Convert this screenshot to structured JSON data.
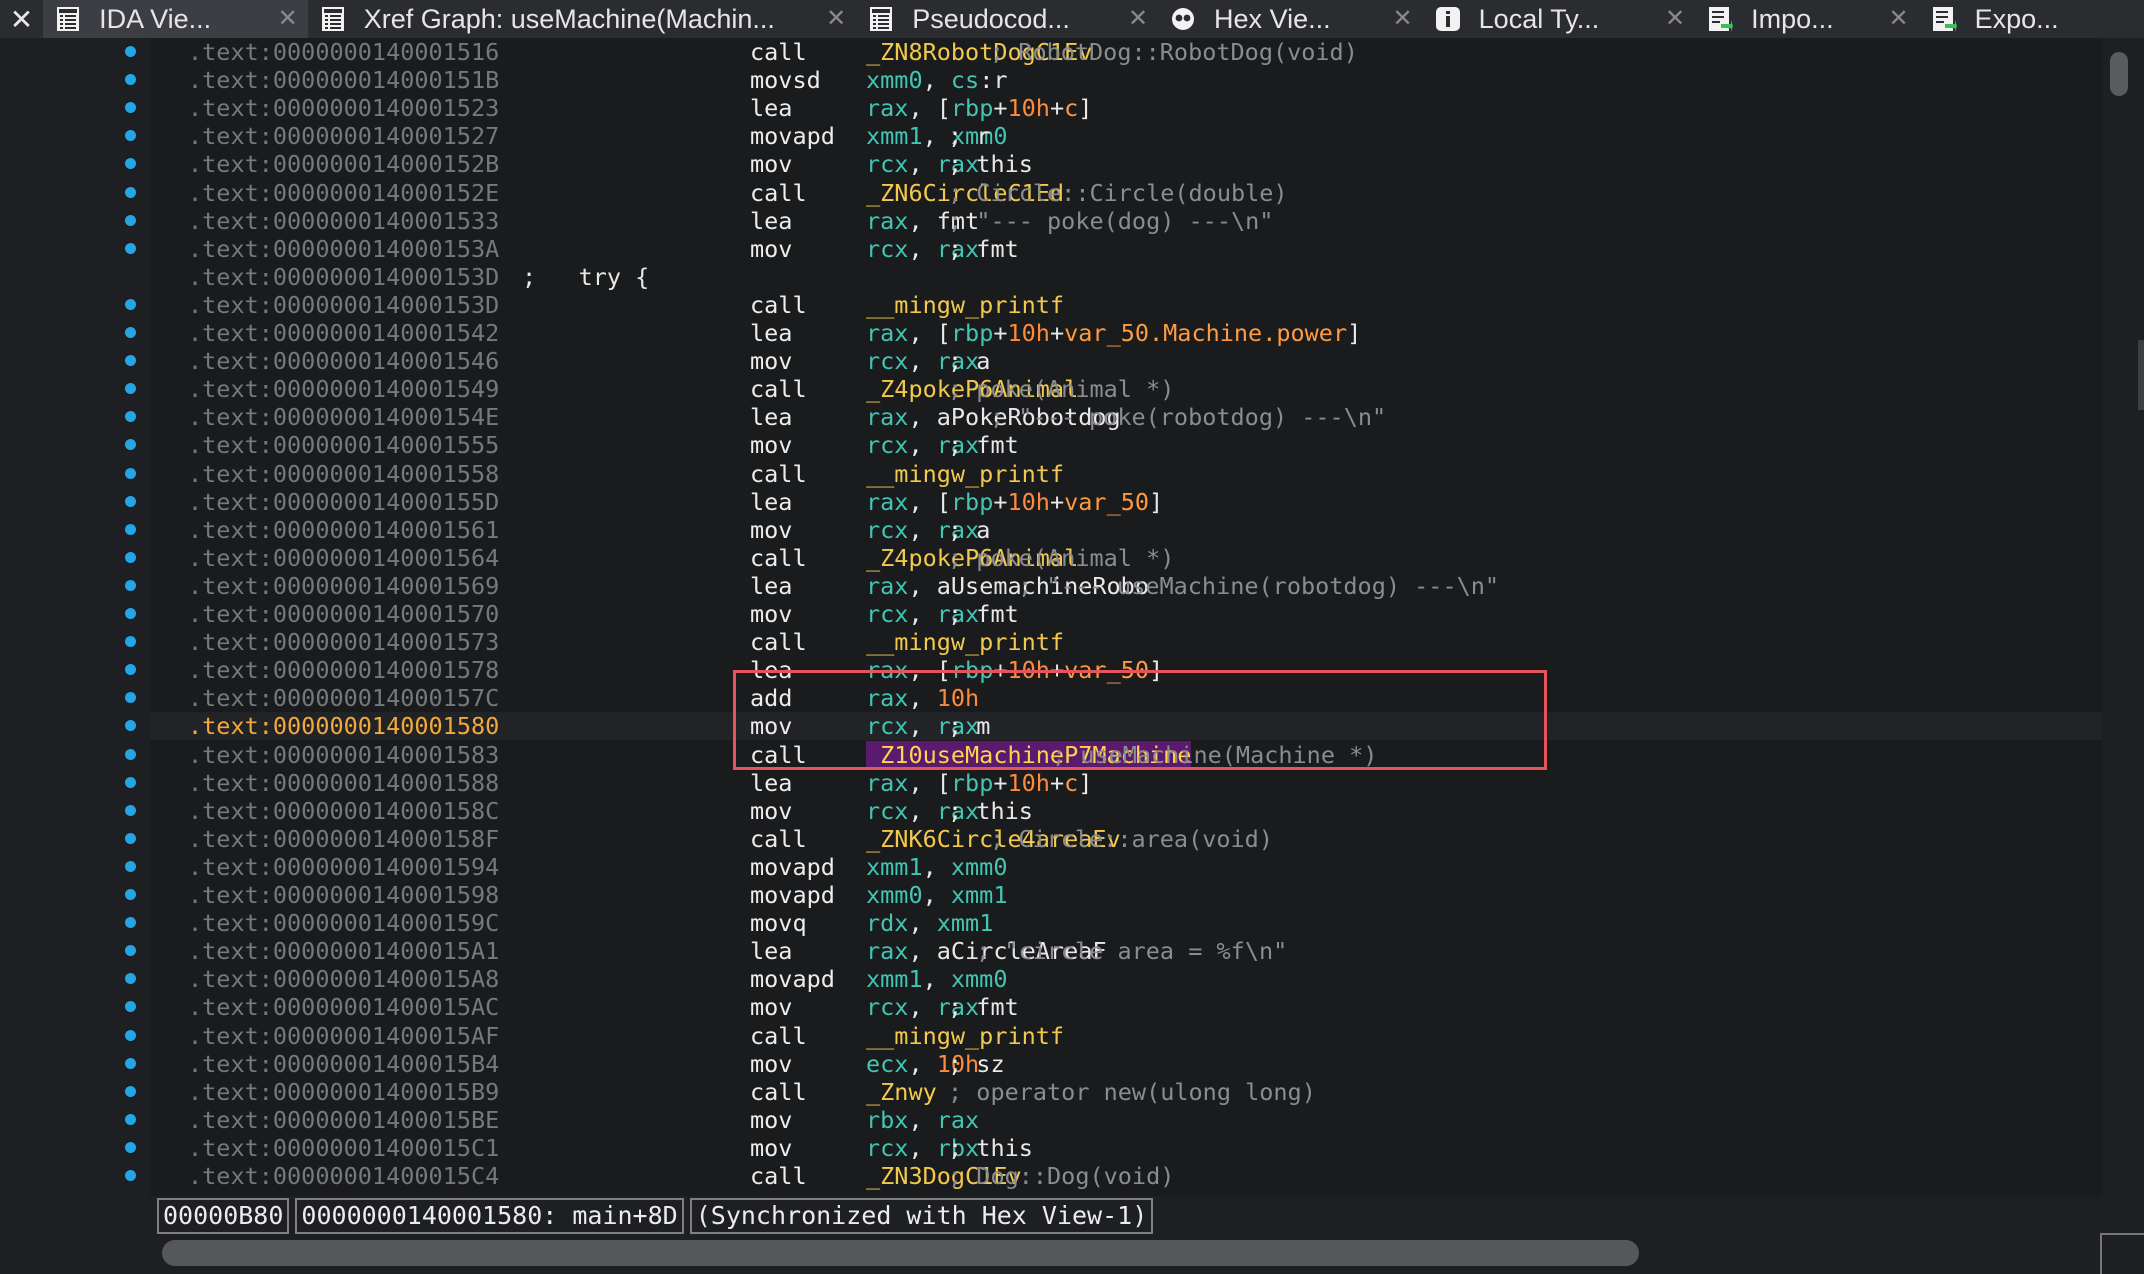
{
  "tabs": [
    {
      "label": "IDA Vie...",
      "icon": "ida-view-icon",
      "active": true,
      "width": 270
    },
    {
      "label": "Xref Graph: useMachine(Machin...",
      "icon": "xref-graph-icon",
      "active": false,
      "width": 560
    },
    {
      "label": "Pseudocod...",
      "icon": "pseudocode-icon",
      "active": false,
      "width": 308
    },
    {
      "label": "Hex Vie...",
      "icon": "hex-view-icon",
      "active": false,
      "width": 270
    },
    {
      "label": "Local Ty...",
      "icon": "local-types-icon",
      "active": false,
      "width": 278
    },
    {
      "label": "Impo...",
      "icon": "imports-icon",
      "active": false,
      "width": 228
    },
    {
      "label": "Expo...",
      "icon": "exports-icon",
      "active": false,
      "width": 230
    }
  ],
  "listing": [
    {
      "addr": ".text:0000000140001516",
      "mn": "call",
      "ops": [
        [
          "s",
          "_ZN8RobotDogC1Ev"
        ]
      ],
      "cmt": "; RobotDog::RobotDog(void)",
      "cmtx": 990
    },
    {
      "addr": ".text:000000014000151B",
      "mn": "movsd",
      "ops": [
        [
          "r",
          "xmm0"
        ],
        [
          "o",
          ", "
        ],
        [
          "r",
          "cs"
        ],
        [
          "o",
          ":r"
        ]
      ]
    },
    {
      "addr": ".text:0000000140001523",
      "mn": "lea",
      "ops": [
        [
          "r",
          "rax"
        ],
        [
          "o",
          ", ["
        ],
        [
          "r",
          "rbp"
        ],
        [
          "o",
          "+"
        ],
        [
          "n",
          "10h"
        ],
        [
          "o",
          "+"
        ],
        [
          "v",
          "c"
        ],
        [
          "o",
          "]"
        ]
      ]
    },
    {
      "addr": ".text:0000000140001527",
      "mn": "movapd",
      "ops": [
        [
          "r",
          "xmm1"
        ],
        [
          "o",
          ", "
        ],
        [
          "r",
          "xmm0"
        ]
      ],
      "cmt": "; r",
      "cmtx": 948,
      "cmtcls": "o"
    },
    {
      "addr": ".text:000000014000152B",
      "mn": "mov",
      "ops": [
        [
          "r",
          "rcx"
        ],
        [
          "o",
          ", "
        ],
        [
          "r",
          "rax"
        ]
      ],
      "cmt": "; this",
      "cmtx": 948,
      "cmtcls": "o"
    },
    {
      "addr": ".text:000000014000152E",
      "mn": "call",
      "ops": [
        [
          "s",
          "_ZN6CircleC1Ed"
        ]
      ],
      "cmt": "; Circle::Circle(double)",
      "cmtx": 948
    },
    {
      "addr": ".text:0000000140001533",
      "mn": "lea",
      "ops": [
        [
          "r",
          "rax"
        ],
        [
          "o",
          ", fmt"
        ]
      ],
      "cmt": "; \"--- poke(dog) ---\\n\"",
      "cmtx": 948
    },
    {
      "addr": ".text:000000014000153A",
      "mn": "mov",
      "ops": [
        [
          "r",
          "rcx"
        ],
        [
          "o",
          ", "
        ],
        [
          "r",
          "rax"
        ]
      ],
      "cmt": "; fmt",
      "cmtx": 948,
      "cmtcls": "o"
    },
    {
      "addr": ".text:000000014000153D",
      "try": ";   try {"
    },
    {
      "addr": ".text:000000014000153D",
      "mn": "call",
      "ops": [
        [
          "s",
          "__mingw_printf"
        ]
      ]
    },
    {
      "addr": ".text:0000000140001542",
      "mn": "lea",
      "ops": [
        [
          "r",
          "rax"
        ],
        [
          "o",
          ", ["
        ],
        [
          "r",
          "rbp"
        ],
        [
          "o",
          "+"
        ],
        [
          "n",
          "10h"
        ],
        [
          "o",
          "+"
        ],
        [
          "v",
          "var_50.Machine.power"
        ],
        [
          "o",
          "]"
        ]
      ]
    },
    {
      "addr": ".text:0000000140001546",
      "mn": "mov",
      "ops": [
        [
          "r",
          "rcx"
        ],
        [
          "o",
          ", "
        ],
        [
          "r",
          "rax"
        ]
      ],
      "cmt": "; a",
      "cmtx": 948,
      "cmtcls": "o"
    },
    {
      "addr": ".text:0000000140001549",
      "mn": "call",
      "ops": [
        [
          "s",
          "_Z4pokeP6Animal"
        ]
      ],
      "cmt": "; poke(Animal *)",
      "cmtx": 948
    },
    {
      "addr": ".text:000000014000154E",
      "mn": "lea",
      "ops": [
        [
          "r",
          "rax"
        ],
        [
          "o",
          ", aPokeRobotdog"
        ]
      ],
      "cmt": "; \"--- poke(robotdog) ---\\n\"",
      "cmtx": 990
    },
    {
      "addr": ".text:0000000140001555",
      "mn": "mov",
      "ops": [
        [
          "r",
          "rcx"
        ],
        [
          "o",
          ", "
        ],
        [
          "r",
          "rax"
        ]
      ],
      "cmt": "; fmt",
      "cmtx": 948,
      "cmtcls": "o"
    },
    {
      "addr": ".text:0000000140001558",
      "mn": "call",
      "ops": [
        [
          "s",
          "__mingw_printf"
        ]
      ]
    },
    {
      "addr": ".text:000000014000155D",
      "mn": "lea",
      "ops": [
        [
          "r",
          "rax"
        ],
        [
          "o",
          ", ["
        ],
        [
          "r",
          "rbp"
        ],
        [
          "o",
          "+"
        ],
        [
          "n",
          "10h"
        ],
        [
          "o",
          "+"
        ],
        [
          "v",
          "var_50"
        ],
        [
          "o",
          "]"
        ]
      ]
    },
    {
      "addr": ".text:0000000140001561",
      "mn": "mov",
      "ops": [
        [
          "r",
          "rcx"
        ],
        [
          "o",
          ", "
        ],
        [
          "r",
          "rax"
        ]
      ],
      "cmt": "; a",
      "cmtx": 948,
      "cmtcls": "o"
    },
    {
      "addr": ".text:0000000140001564",
      "mn": "call",
      "ops": [
        [
          "s",
          "_Z4pokeP6Animal"
        ]
      ],
      "cmt": "; poke(Animal *)",
      "cmtx": 948
    },
    {
      "addr": ".text:0000000140001569",
      "mn": "lea",
      "ops": [
        [
          "r",
          "rax"
        ],
        [
          "o",
          ", aUsemachineRobo"
        ]
      ],
      "cmt": "; \"--- useMachine(robotdog) ---\\n\"",
      "cmtx": 1018
    },
    {
      "addr": ".text:0000000140001570",
      "mn": "mov",
      "ops": [
        [
          "r",
          "rcx"
        ],
        [
          "o",
          ", "
        ],
        [
          "r",
          "rax"
        ]
      ],
      "cmt": "; fmt",
      "cmtx": 948,
      "cmtcls": "o"
    },
    {
      "addr": ".text:0000000140001573",
      "mn": "call",
      "ops": [
        [
          "s",
          "__mingw_printf"
        ]
      ]
    },
    {
      "addr": ".text:0000000140001578",
      "mn": "lea",
      "ops": [
        [
          "r",
          "rax"
        ],
        [
          "o",
          ", ["
        ],
        [
          "r",
          "rbp"
        ],
        [
          "o",
          "+"
        ],
        [
          "n",
          "10h"
        ],
        [
          "o",
          "+"
        ],
        [
          "v",
          "var_50"
        ],
        [
          "o",
          "]"
        ]
      ]
    },
    {
      "addr": ".text:000000014000157C",
      "mn": "add",
      "ops": [
        [
          "r",
          "rax"
        ],
        [
          "o",
          ", "
        ],
        [
          "n",
          "10h"
        ]
      ]
    },
    {
      "addr": ".text:0000000140001580",
      "mn": "mov",
      "ops": [
        [
          "r",
          "rcx"
        ],
        [
          "o",
          ", "
        ],
        [
          "r",
          "rax"
        ]
      ],
      "cmt": "; m",
      "cmtx": 948,
      "cmtcls": "o",
      "current": true
    },
    {
      "addr": ".text:0000000140001583",
      "mn": "call",
      "ops": [
        [
          "hl",
          "_Z10useMachineP7Machine"
        ]
      ],
      "cmt": "; useMachine(Machine *)",
      "cmtx": 1052
    },
    {
      "addr": ".text:0000000140001588",
      "mn": "lea",
      "ops": [
        [
          "r",
          "rax"
        ],
        [
          "o",
          ", ["
        ],
        [
          "r",
          "rbp"
        ],
        [
          "o",
          "+"
        ],
        [
          "n",
          "10h"
        ],
        [
          "o",
          "+"
        ],
        [
          "v",
          "c"
        ],
        [
          "o",
          "]"
        ]
      ]
    },
    {
      "addr": ".text:000000014000158C",
      "mn": "mov",
      "ops": [
        [
          "r",
          "rcx"
        ],
        [
          "o",
          ", "
        ],
        [
          "r",
          "rax"
        ]
      ],
      "cmt": "; this",
      "cmtx": 948,
      "cmtcls": "o"
    },
    {
      "addr": ".text:000000014000158F",
      "mn": "call",
      "ops": [
        [
          "s",
          "_ZNK6Circle4areaEv"
        ]
      ],
      "cmt": "; Circle::area(void)",
      "cmtx": 990
    },
    {
      "addr": ".text:0000000140001594",
      "mn": "movapd",
      "ops": [
        [
          "r",
          "xmm1"
        ],
        [
          "o",
          ", "
        ],
        [
          "r",
          "xmm0"
        ]
      ]
    },
    {
      "addr": ".text:0000000140001598",
      "mn": "movapd",
      "ops": [
        [
          "r",
          "xmm0"
        ],
        [
          "o",
          ", "
        ],
        [
          "r",
          "xmm1"
        ]
      ]
    },
    {
      "addr": ".text:000000014000159C",
      "mn": "movq",
      "ops": [
        [
          "r",
          "rdx"
        ],
        [
          "o",
          ", "
        ],
        [
          "r",
          "xmm1"
        ]
      ]
    },
    {
      "addr": ".text:00000001400015A1",
      "mn": "lea",
      "ops": [
        [
          "r",
          "rax"
        ],
        [
          "o",
          ", aCircleAreaF"
        ]
      ],
      "cmt": "; \"circle area = %f\\n\"",
      "cmtx": 976
    },
    {
      "addr": ".text:00000001400015A8",
      "mn": "movapd",
      "ops": [
        [
          "r",
          "xmm1"
        ],
        [
          "o",
          ", "
        ],
        [
          "r",
          "xmm0"
        ]
      ]
    },
    {
      "addr": ".text:00000001400015AC",
      "mn": "mov",
      "ops": [
        [
          "r",
          "rcx"
        ],
        [
          "o",
          ", "
        ],
        [
          "r",
          "rax"
        ]
      ],
      "cmt": "; fmt",
      "cmtx": 948,
      "cmtcls": "o"
    },
    {
      "addr": ".text:00000001400015AF",
      "mn": "call",
      "ops": [
        [
          "s",
          "__mingw_printf"
        ]
      ]
    },
    {
      "addr": ".text:00000001400015B4",
      "mn": "mov",
      "ops": [
        [
          "r",
          "ecx"
        ],
        [
          "o",
          ", "
        ],
        [
          "n",
          "10h"
        ]
      ],
      "cmt": "; sz",
      "cmtx": 948,
      "cmtcls": "o"
    },
    {
      "addr": ".text:00000001400015B9",
      "mn": "call",
      "ops": [
        [
          "s",
          "_Znwy"
        ]
      ],
      "cmt": "; operator new(ulong long)",
      "cmtx": 948
    },
    {
      "addr": ".text:00000001400015BE",
      "mn": "mov",
      "ops": [
        [
          "r",
          "rbx"
        ],
        [
          "o",
          ", "
        ],
        [
          "r",
          "rax"
        ]
      ]
    },
    {
      "addr": ".text:00000001400015C1",
      "mn": "mov",
      "ops": [
        [
          "r",
          "rcx"
        ],
        [
          "o",
          ", "
        ],
        [
          "r",
          "rbx"
        ]
      ],
      "cmt": "; this",
      "cmtx": 948,
      "cmtcls": "o"
    },
    {
      "addr": ".text:00000001400015C4",
      "mn": "call",
      "ops": [
        [
          "s",
          "_ZN3DogC1Ev"
        ]
      ],
      "cmt": "; Dog::Dog(void)",
      "cmtx": 948
    }
  ],
  "status": {
    "offset": "00000B80",
    "location": "0000000140001580: main+8D",
    "sync": "(Synchronized with Hex View-1)"
  },
  "colors": {
    "accent_dot": "#22a7e6",
    "highlight_box": "#e2555a",
    "current_address": "#f2a93b"
  }
}
